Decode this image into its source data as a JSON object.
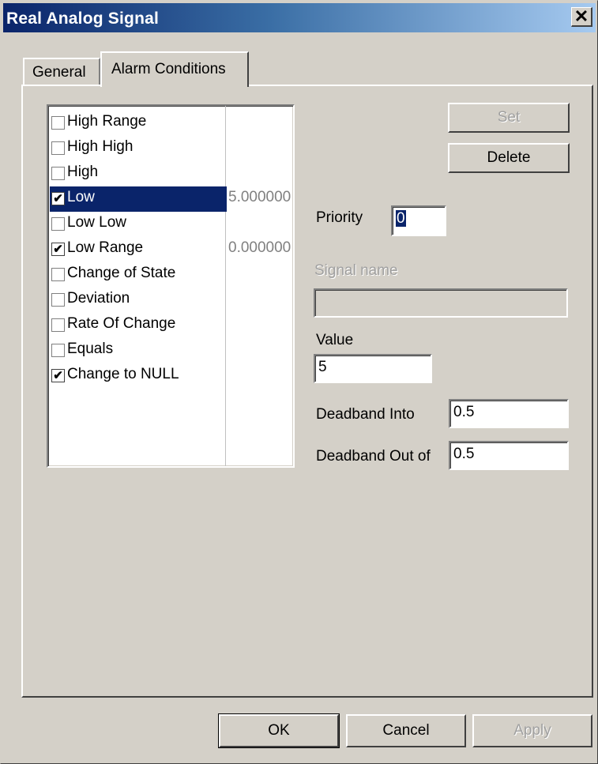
{
  "window": {
    "title": "Real Analog Signal",
    "close_glyph": "✕"
  },
  "tabs": [
    {
      "label": "General",
      "active": false
    },
    {
      "label": "Alarm Conditions",
      "active": true
    }
  ],
  "alarm_list": {
    "items": [
      {
        "label": "High Range",
        "checked": false,
        "value": ""
      },
      {
        "label": "High High",
        "checked": false,
        "value": ""
      },
      {
        "label": "High",
        "checked": false,
        "value": ""
      },
      {
        "label": "Low",
        "checked": true,
        "value": "5.000000",
        "selected": true
      },
      {
        "label": "Low Low",
        "checked": false,
        "value": ""
      },
      {
        "label": "Low Range",
        "checked": true,
        "value": "0.000000"
      },
      {
        "label": "Change of State",
        "checked": false,
        "value": ""
      },
      {
        "label": "Deviation",
        "checked": false,
        "value": ""
      },
      {
        "label": "Rate Of Change",
        "checked": false,
        "value": ""
      },
      {
        "label": "Equals",
        "checked": false,
        "value": ""
      },
      {
        "label": "Change to NULL",
        "checked": true,
        "value": ""
      }
    ]
  },
  "buttons": {
    "set": "Set",
    "delete": "Delete",
    "ok": "OK",
    "cancel": "Cancel",
    "apply": "Apply"
  },
  "form": {
    "priority_label": "Priority",
    "priority_value": "0",
    "signal_name_label": "Signal name",
    "signal_name_value": "",
    "value_label": "Value",
    "value_value": "5",
    "deadband_into_label": "Deadband Into",
    "deadband_into_value": "0.5",
    "deadband_out_label": "Deadband Out of",
    "deadband_out_value": "0.5"
  },
  "colors": {
    "face": "#d4d0c8",
    "title_start": "#0a246a",
    "title_end": "#a6caf0",
    "selection": "#0a246a"
  }
}
